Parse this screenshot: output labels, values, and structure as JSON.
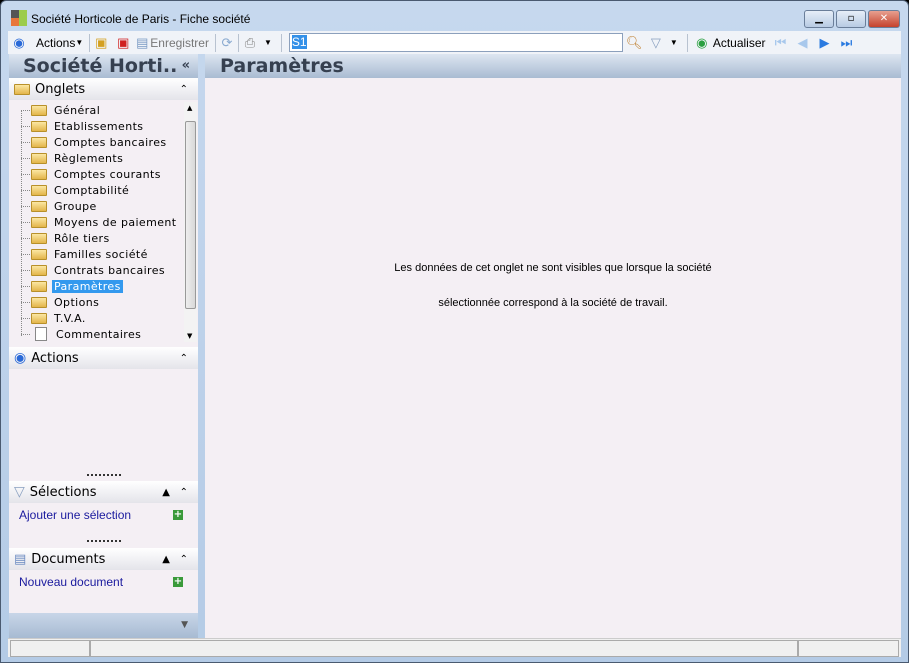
{
  "window": {
    "title": "Société Horticole de Paris -  Fiche société"
  },
  "toolbar": {
    "actions_label": "Actions",
    "save_label": "Enregistrer",
    "search_value": "S1",
    "refresh_label": "Actualiser"
  },
  "left": {
    "title": "Société Horti..",
    "tabs_section": {
      "label": "Onglets",
      "items": [
        {
          "label": "Général"
        },
        {
          "label": "Etablissements"
        },
        {
          "label": "Comptes bancaires"
        },
        {
          "label": "Règlements"
        },
        {
          "label": "Comptes courants"
        },
        {
          "label": "Comptabilité"
        },
        {
          "label": "Groupe"
        },
        {
          "label": "Moyens de paiement"
        },
        {
          "label": "Rôle tiers"
        },
        {
          "label": "Familles société"
        },
        {
          "label": "Contrats bancaires"
        },
        {
          "label": "Paramètres",
          "selected": true
        },
        {
          "label": "Options"
        },
        {
          "label": "T.V.A."
        },
        {
          "label": "Commentaires"
        }
      ]
    },
    "actions_section": {
      "label": "Actions"
    },
    "selections_section": {
      "label": "Sélections",
      "link": "Ajouter une sélection"
    },
    "documents_section": {
      "label": "Documents",
      "link": "Nouveau document"
    }
  },
  "main": {
    "title": "Paramètres",
    "message_line1": "Les données de cet onglet ne sont visibles que lorsque la société",
    "message_line2": "sélectionnée correspond à la société de travail."
  }
}
